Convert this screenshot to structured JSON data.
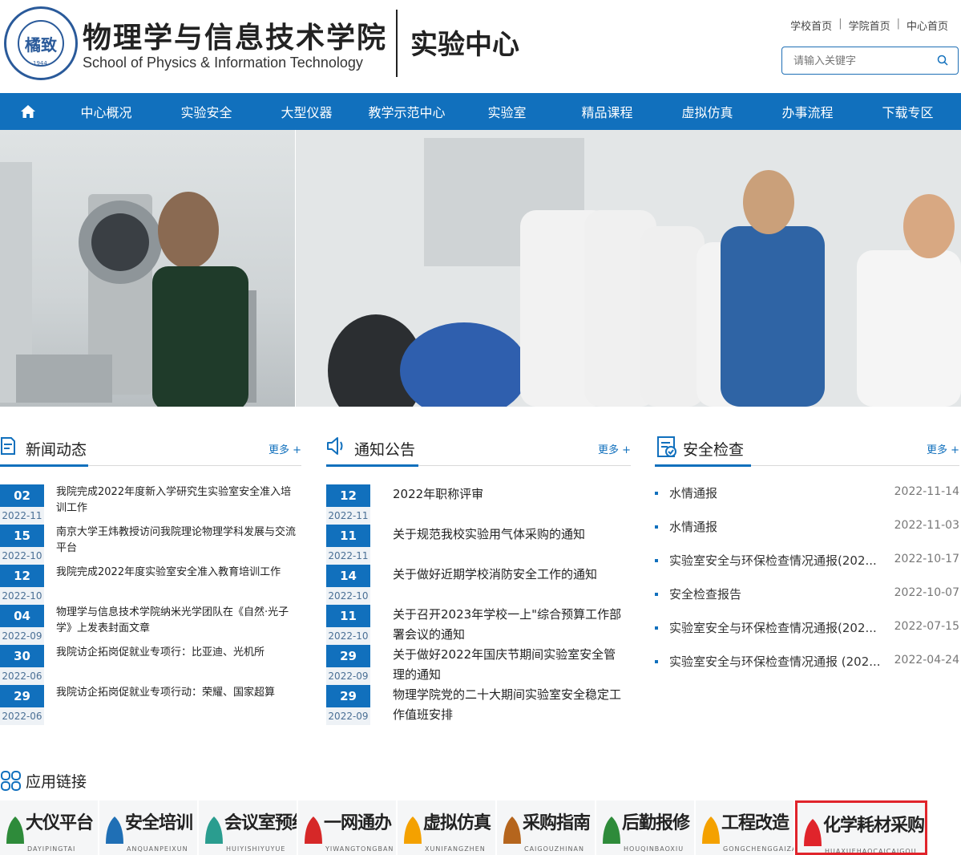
{
  "header": {
    "school_cn": "物理学与信息技术学院",
    "school_en": "School of Physics & Information Technology",
    "center_name": "实验中心",
    "seal_text": "橘致",
    "seal_year": "1944",
    "toplinks": [
      "学校首页",
      "学院首页",
      "中心首页"
    ],
    "search_placeholder": "请输入关键字"
  },
  "nav": {
    "items": [
      "中心概况",
      "实验安全",
      "大型仪器",
      "教学示范中心",
      "实验室",
      "精品课程",
      "虚拟仿真",
      "办事流程",
      "下载专区"
    ]
  },
  "news": {
    "title": "新闻动态",
    "more": "更多 +",
    "items": [
      {
        "day": "02",
        "ym": "2022-11",
        "text": "我院完成2022年度新入学研究生实验室安全准入培训工作"
      },
      {
        "day": "15",
        "ym": "2022-10",
        "text": "南京大学王炜教授访问我院理论物理学科发展与交流平台"
      },
      {
        "day": "12",
        "ym": "2022-10",
        "text": "我院完成2022年度实验室安全准入教育培训工作"
      },
      {
        "day": "04",
        "ym": "2022-09",
        "text": "物理学与信息技术学院纳米光学团队在《自然·光子学》上发表封面文章"
      },
      {
        "day": "30",
        "ym": "2022-06",
        "text": "我院访企拓岗促就业专项行：比亚迪、光机所"
      },
      {
        "day": "29",
        "ym": "2022-06",
        "text": "我院访企拓岗促就业专项行动：荣耀、国家超算"
      }
    ]
  },
  "notice": {
    "title": "通知公告",
    "more": "更多 +",
    "items": [
      {
        "day": "12",
        "ym": "2022-11",
        "text": "2022年职称评审"
      },
      {
        "day": "11",
        "ym": "2022-11",
        "text": "关于规范我校实验用气体采购的通知"
      },
      {
        "day": "14",
        "ym": "2022-10",
        "text": "关于做好近期学校消防安全工作的通知"
      },
      {
        "day": "11",
        "ym": "2022-10",
        "text": "关于召开2023年学校一上\"综合预算工作部署会议的通知"
      },
      {
        "day": "29",
        "ym": "2022-09",
        "text": "关于做好2022年国庆节期间实验室安全管理的通知"
      },
      {
        "day": "29",
        "ym": "2022-09",
        "text": "物理学院党的二十大期间实验室安全稳定工作值班安排"
      }
    ]
  },
  "safety": {
    "title": "安全检查",
    "more": "更多 +",
    "items": [
      {
        "text": "水情通报",
        "date": "2022-11-14"
      },
      {
        "text": "水情通报",
        "date": "2022-11-03"
      },
      {
        "text": "实验室安全与环保检查情况通报(202...",
        "date": "2022-10-17"
      },
      {
        "text": "安全检查报告",
        "date": "2022-10-07"
      },
      {
        "text": "实验室安全与环保检查情况通报(202...",
        "date": "2022-07-15"
      },
      {
        "text": "实验室安全与环保检查情况通报 (202...",
        "date": "2022-04-24"
      }
    ]
  },
  "apps": {
    "title": "应用链接",
    "items": [
      {
        "name": "大仪平台",
        "pinyin": "DAYIPINGTAI",
        "color": "#2e8b3a"
      },
      {
        "name": "安全培训",
        "pinyin": "ANQUANPEIXUN",
        "color": "#1f6fb5"
      },
      {
        "name": "会议室预约",
        "pinyin": "HUIYISHIYUYUE",
        "color": "#2a9d8f"
      },
      {
        "name": "一网通办",
        "pinyin": "YIWANGTONGBAN",
        "color": "#d62828"
      },
      {
        "name": "虚拟仿真",
        "pinyin": "XUNIFANGZHEN",
        "color": "#f4a100"
      },
      {
        "name": "采购指南",
        "pinyin": "CAIGOUZHINAN",
        "color": "#b5651d"
      },
      {
        "name": "后勤报修",
        "pinyin": "HOUQINBAOXIU",
        "color": "#2e8b3a"
      },
      {
        "name": "工程改造",
        "pinyin": "GONGCHENGGAIZAO",
        "color": "#f4a100"
      },
      {
        "name": "化学耗材采购",
        "pinyin": "HUAXUEHAOCAICAIGOU",
        "color": "#e0242b"
      }
    ]
  },
  "colors": {
    "primary": "#1170bd",
    "highlight": "#e0242b"
  }
}
